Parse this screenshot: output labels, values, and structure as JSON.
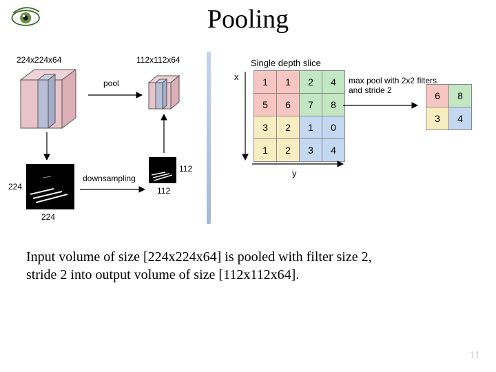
{
  "title": "Pooling",
  "left": {
    "inVolumeLabel": "224x224x64",
    "outVolumeLabel": "112x112x64",
    "poolLabel": "pool",
    "downsamplingLabel": "downsampling",
    "inImgW": "224",
    "inImgH": "224",
    "outImgW": "112",
    "outImgH": "112"
  },
  "right": {
    "sliceTitle": "Single depth slice",
    "xLabel": "x",
    "yLabel": "y",
    "poolDesc1": "max pool with 2x2 filters",
    "poolDesc2": "and stride 2",
    "grid": [
      [
        "1",
        "1",
        "2",
        "4"
      ],
      [
        "5",
        "6",
        "7",
        "8"
      ],
      [
        "3",
        "2",
        "1",
        "0"
      ],
      [
        "1",
        "2",
        "3",
        "4"
      ]
    ],
    "out": [
      [
        "6",
        "8"
      ],
      [
        "3",
        "4"
      ]
    ]
  },
  "caption1": "Input volume of size [224x224x64] is pooled with filter size 2,",
  "caption2": "stride 2 into output volume of size [112x112x64].",
  "pagenum": "11"
}
